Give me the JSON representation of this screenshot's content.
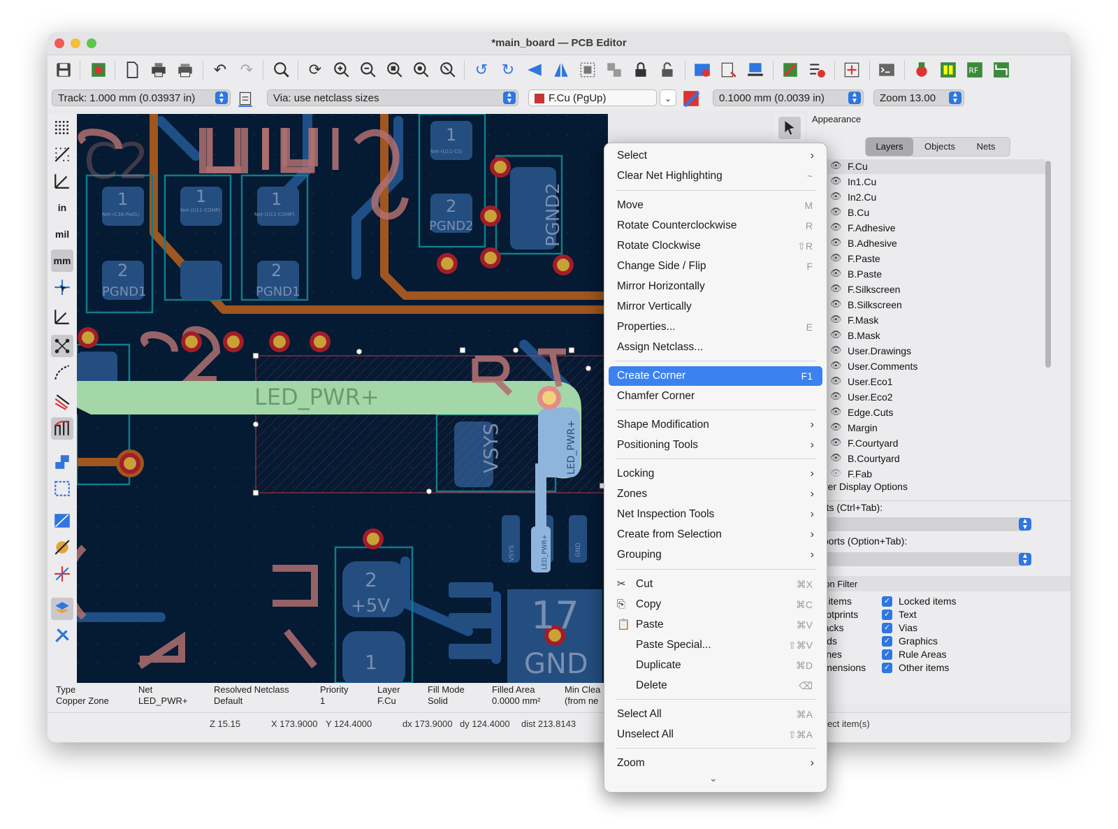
{
  "window": {
    "title": "*main_board — PCB Editor",
    "traffic_colors": [
      "#ee5b55",
      "#f4bd3a",
      "#5dc64a"
    ]
  },
  "optbar": {
    "track": "Track: 1.000 mm (0.03937 in)",
    "via": "Via: use netclass sizes",
    "layer": "F.Cu (PgUp)",
    "grid": "0.1000 mm (0.0039 in)",
    "zoom": "Zoom 13.00"
  },
  "left_tools": {
    "units_in": "in",
    "units_mil": "mil",
    "units_mm": "mm"
  },
  "canvas": {
    "ref_u11": "U11",
    "ref_c2": "C2",
    "pad_net_c38": "Net-(C38-Pad1)",
    "pad_net_u11comp_a": "Net-(U11-COMP)",
    "pad_net_u11comp_b": "Net-(U11-COMP)",
    "pad_net_u11cs": "Net-(U11-CS)",
    "pad_num_1": "1",
    "pad_num_2": "2",
    "pgnd1": "PGND1",
    "pgnd2": "PGND2",
    "net_label": "LED_PWR+",
    "vsys": "VSYS",
    "led_pwr_pad": "LED_PWR+",
    "plus5v": "+5V",
    "gnd": "GND",
    "pad_17": "17",
    "ref_r12": "R12"
  },
  "info_bar": {
    "type_label": "Type",
    "type_value": "Copper Zone",
    "net_label": "Net",
    "net_value": "LED_PWR+",
    "netclass_label": "Resolved Netclass",
    "netclass_value": "Default",
    "priority_label": "Priority",
    "priority_value": "1",
    "layer_label": "Layer",
    "layer_value": "F.Cu",
    "fill_label": "Fill Mode",
    "fill_value": "Solid",
    "area_label": "Filled Area",
    "area_value": "0.0000 mm²",
    "clear_label": "Min Clea",
    "clear_value": "(from ne"
  },
  "status_bar": {
    "z": "Z 15.15",
    "x": "X 173.9000",
    "y": "Y 124.4000",
    "dx": "dx 173.9000",
    "dy": "dy 124.4000",
    "dist": "dist 213.8143",
    "right": "ect item(s)"
  },
  "appearance": {
    "title": "Appearance",
    "tabs": [
      "Layers",
      "Objects",
      "Nets"
    ],
    "layers": [
      {
        "name": "F.Cu",
        "color": "#c83434"
      },
      {
        "name": "In1.Cu",
        "color": "#7fc87f"
      },
      {
        "name": "In2.Cu",
        "color": "#c8844a"
      },
      {
        "name": "B.Cu",
        "color": "#4d7fc4"
      },
      {
        "name": "F.Adhesive",
        "color": "#84118a"
      },
      {
        "name": "B.Adhesive",
        "color": "#00005e"
      },
      {
        "name": "F.Paste",
        "color": "#a39a91"
      },
      {
        "name": "B.Paste",
        "color": "#00c2c2"
      },
      {
        "name": "F.Silkscreen",
        "color": "#f2eda1"
      },
      {
        "name": "B.Silkscreen",
        "color": "#e8b2a7"
      },
      {
        "name": "F.Mask",
        "color": "#84348a"
      },
      {
        "name": "B.Mask",
        "color": "#028a8a"
      },
      {
        "name": "User.Drawings",
        "color": "#c2c2c2"
      },
      {
        "name": "User.Comments",
        "color": "#5987d4"
      },
      {
        "name": "User.Eco1",
        "color": "#b4dbd2"
      },
      {
        "name": "User.Eco2",
        "color": "#d8c852"
      },
      {
        "name": "Edge.Cuts",
        "color": "#d0d2cd"
      },
      {
        "name": "Margin",
        "color": "#ff26e2"
      },
      {
        "name": "F.Courtyard",
        "color": "#ff26e2"
      },
      {
        "name": "B.Courtyard",
        "color": "#26e9ff"
      },
      {
        "name": "F.Fab",
        "color": "#afafaf"
      }
    ],
    "layer_display_options": "Layer Display Options",
    "presets": "esets (Ctrl+Tab):",
    "viewports": "ewports (Option+Tab):",
    "selection_filter": "ection Filter",
    "filter_left": [
      "All items",
      "Footprints",
      "Tracks",
      "Pads",
      "Zones",
      "Dimensions"
    ],
    "filter_right": [
      "Locked items",
      "Text",
      "Vias",
      "Graphics",
      "Rule Areas",
      "Other items"
    ]
  },
  "context_menu": {
    "items": [
      {
        "label": "Select",
        "shortcut": "",
        "sub": true
      },
      {
        "label": "Clear Net Highlighting",
        "shortcut": "~",
        "sub": false
      },
      {
        "label": "Move",
        "shortcut": "M",
        "sub": false
      },
      {
        "label": "Rotate Counterclockwise",
        "shortcut": "R",
        "sub": false
      },
      {
        "label": "Rotate Clockwise",
        "shortcut": "⇧R",
        "sub": false
      },
      {
        "label": "Change Side / Flip",
        "shortcut": "F",
        "sub": false
      },
      {
        "label": "Mirror Horizontally",
        "shortcut": "",
        "sub": false
      },
      {
        "label": "Mirror Vertically",
        "shortcut": "",
        "sub": false
      },
      {
        "label": "Properties...",
        "shortcut": "E",
        "sub": false
      },
      {
        "label": "Assign Netclass...",
        "shortcut": "",
        "sub": false
      },
      {
        "label": "Create Corner",
        "shortcut": "F1",
        "sub": false
      },
      {
        "label": "Chamfer Corner",
        "shortcut": "",
        "sub": false
      },
      {
        "label": "Shape Modification",
        "shortcut": "",
        "sub": true
      },
      {
        "label": "Positioning Tools",
        "shortcut": "",
        "sub": true
      },
      {
        "label": "Locking",
        "shortcut": "",
        "sub": true
      },
      {
        "label": "Zones",
        "shortcut": "",
        "sub": true
      },
      {
        "label": "Net Inspection Tools",
        "shortcut": "",
        "sub": true
      },
      {
        "label": "Create from Selection",
        "shortcut": "",
        "sub": true
      },
      {
        "label": "Grouping",
        "shortcut": "",
        "sub": true
      },
      {
        "label": "Cut",
        "shortcut": "⌘X",
        "sub": false
      },
      {
        "label": "Copy",
        "shortcut": "⌘C",
        "sub": false
      },
      {
        "label": "Paste",
        "shortcut": "⌘V",
        "sub": false
      },
      {
        "label": "Paste Special...",
        "shortcut": "⇧⌘V",
        "sub": false
      },
      {
        "label": "Duplicate",
        "shortcut": "⌘D",
        "sub": false
      },
      {
        "label": "Delete",
        "shortcut": "⌫",
        "sub": false
      },
      {
        "label": "Select All",
        "shortcut": "⌘A",
        "sub": false
      },
      {
        "label": "Unselect All",
        "shortcut": "⇧⌘A",
        "sub": false
      },
      {
        "label": "Zoom",
        "shortcut": "",
        "sub": true
      }
    ],
    "highlighted": "Create Corner",
    "icons": {
      "cut": "scissors-icon",
      "copy": "copy-icon",
      "paste": "paste-icon"
    }
  }
}
